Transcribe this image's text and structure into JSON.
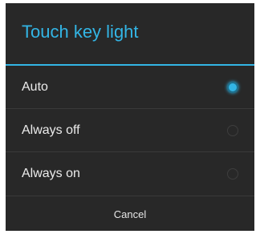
{
  "dialog": {
    "title": "Touch key light",
    "accent_color": "#33b5e5",
    "background_color": "#282828",
    "options": [
      {
        "label": "Auto",
        "selected": true
      },
      {
        "label": "Always off",
        "selected": false
      },
      {
        "label": "Always on",
        "selected": false
      }
    ],
    "cancel_label": "Cancel"
  }
}
